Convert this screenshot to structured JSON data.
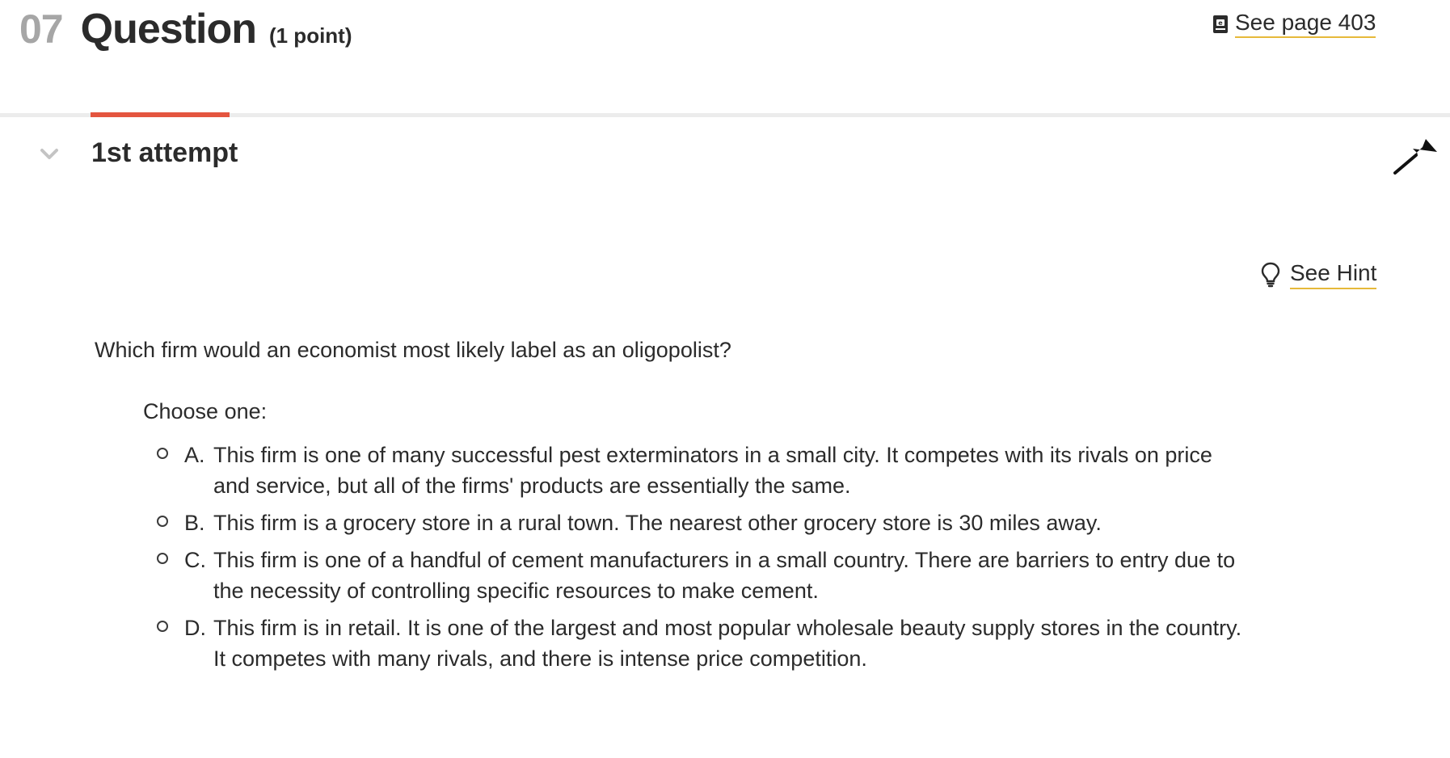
{
  "header": {
    "number": "07",
    "title": "Question",
    "points": "(1 point)",
    "page_link": "See page 403",
    "page_link_icon": "ebook-icon"
  },
  "tabs": [
    {
      "label": "1st attempt",
      "active": true
    }
  ],
  "hint": {
    "label": "See Hint",
    "icon": "lightbulb-icon"
  },
  "question": {
    "prompt": "Which firm would an economist most likely label as an oligopolist?",
    "instruction": "Choose one:",
    "options": [
      {
        "letter": "A.",
        "text": "This firm is one of many successful pest exterminators in a small city. It competes with its rivals on price and service, but all of the firms' products are essentially the same."
      },
      {
        "letter": "B.",
        "text": "This firm is a grocery store in a rural town. The nearest other grocery store is 30 miles away."
      },
      {
        "letter": "C.",
        "text": "This firm is one of a handful of cement manufacturers in a small country. There are barriers to entry due to the necessity of controlling specific resources to make cement."
      },
      {
        "letter": "D.",
        "text": "This firm is in retail. It is one of the largest and most popular wholesale beauty supply stores in the country. It competes with many rivals, and there is intense price competition."
      }
    ]
  },
  "colors": {
    "accent_tab": "#e4553f",
    "link_underline": "#e6b93a",
    "muted_number": "#a6a6a6",
    "text": "#2b2b2b"
  }
}
